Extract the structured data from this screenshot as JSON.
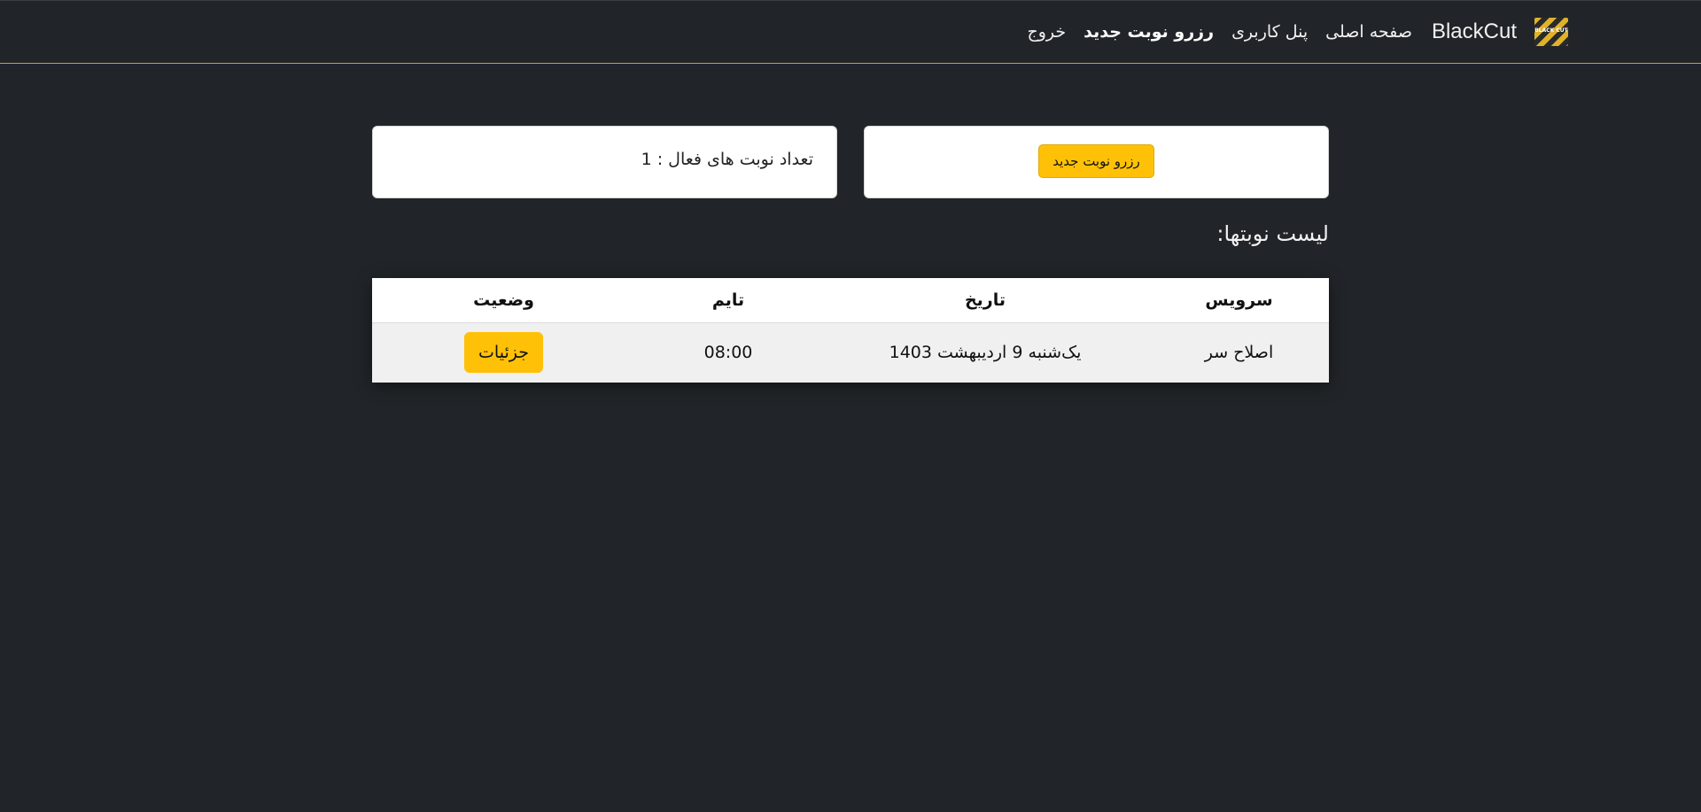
{
  "nav": {
    "brand": "BlackCut",
    "logo_text": "BLACK CUT",
    "links": [
      {
        "label": "صفحه اصلی",
        "active": false
      },
      {
        "label": "پنل کاربری",
        "active": false
      },
      {
        "label": "رزرو نوبت جدید",
        "active": true
      },
      {
        "label": "خروج",
        "active": false
      }
    ]
  },
  "cards": {
    "reserve_button": "رزرو نوبت جدید",
    "active_count": "تعداد نوبت های فعال : 1"
  },
  "list": {
    "title": "لیست نوبتها:",
    "headers": {
      "service": "سرویس",
      "date": "تاریخ",
      "time": "تایم",
      "status": "وضعیت"
    },
    "rows": [
      {
        "service": "اصلاح سر",
        "date": "یک‌شنبه 9 اردیبهشت 1403",
        "time": "08:00",
        "status_button": "جزئیات"
      }
    ]
  },
  "colors": {
    "background": "#212529",
    "accent": "#ffc107"
  }
}
